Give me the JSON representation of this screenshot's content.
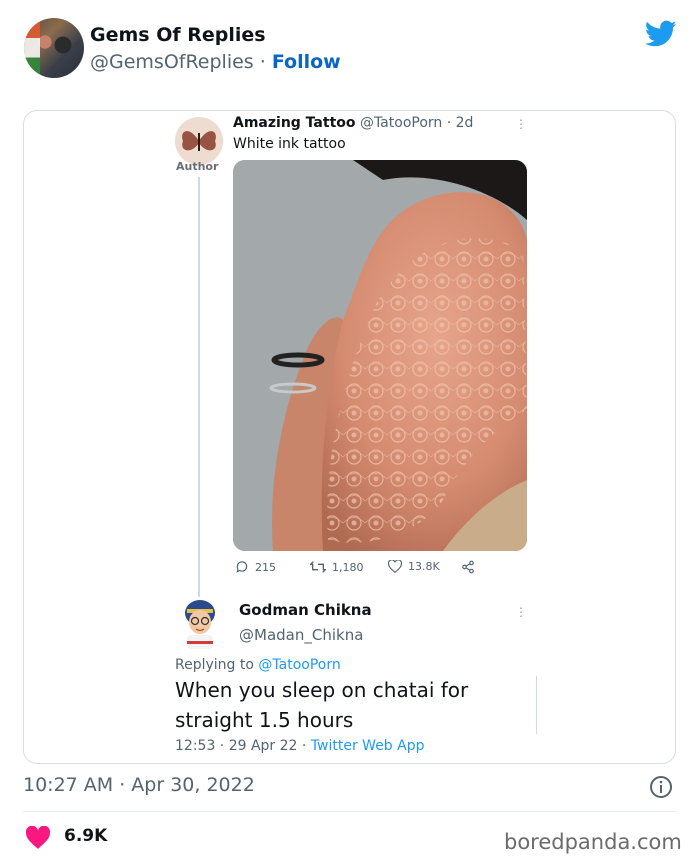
{
  "header": {
    "name": "Gems Of Replies",
    "handle": "@GemsOfReplies",
    "separator": " · ",
    "follow_label": "Follow"
  },
  "embedded_thread": {
    "tweet1": {
      "author_name": "Amazing Tattoo",
      "author_meta": " @TatooPorn · 2d",
      "author_badge": "Author",
      "text": "White ink tattoo",
      "menu": "⋮",
      "stats": {
        "replies": "215",
        "retweets": "1,180",
        "likes": "13.8K"
      }
    },
    "tweet2": {
      "author_name": "Godman Chikna",
      "author_handle": "@Madan_Chikna",
      "menu": "⋮",
      "replying_prefix": "Replying to ",
      "replying_to": "@TatooPorn",
      "text": "When you sleep on chatai for straight 1.5 hours",
      "meta_time": "12:53 · 29 Apr 22 · ",
      "meta_app": "Twitter Web App"
    }
  },
  "footer": {
    "timestamp": "10:27 AM · Apr 30, 2022",
    "likes_count": "6.9K",
    "watermark": "boredpanda.com"
  },
  "colors": {
    "accent_blue": "#1d9bf0",
    "follow_blue": "#0a66c2",
    "heart_red": "#f91880",
    "muted_text": "#536471"
  }
}
